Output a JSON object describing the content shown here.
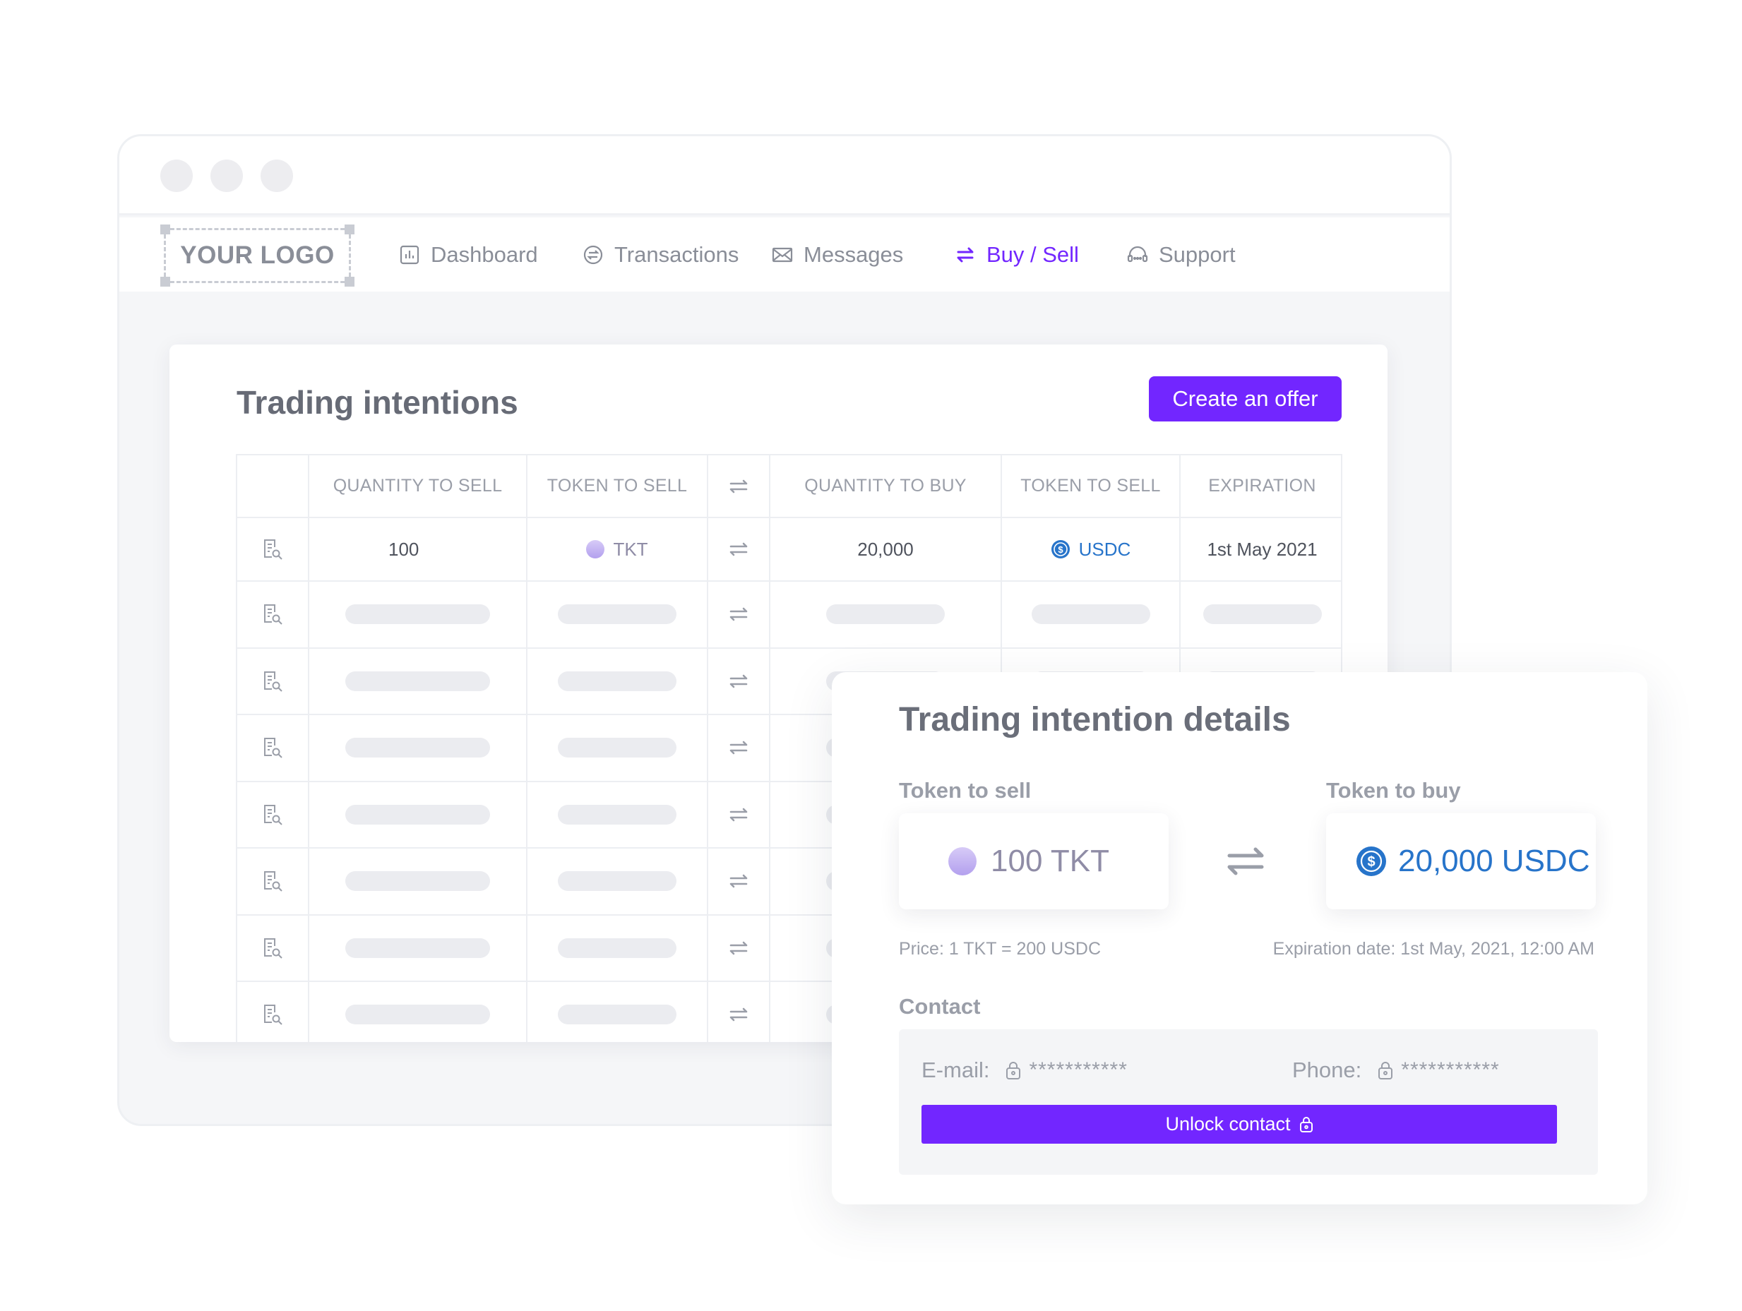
{
  "logo": "YOUR LOGO",
  "nav": [
    {
      "label": "Dashboard",
      "icon": "chart-icon"
    },
    {
      "label": "Transactions",
      "icon": "transactions-icon"
    },
    {
      "label": "Messages",
      "icon": "envelope-icon"
    },
    {
      "label": "Buy / Sell",
      "icon": "swap-icon",
      "active": true
    },
    {
      "label": "Support",
      "icon": "headset-icon"
    }
  ],
  "main": {
    "title": "Trading intentions",
    "create_button": "Create an offer",
    "table": {
      "headers": [
        "",
        "QUANTITY TO SELL",
        "TOKEN TO SELL",
        "",
        "QUANTITY TO BUY",
        "TOKEN TO SELL",
        "EXPIRATION"
      ],
      "first_row": {
        "quantity_to_sell": "100",
        "token_to_sell": "TKT",
        "quantity_to_buy": "20,000",
        "token_to_buy": "USDC",
        "expiration": "1st May 2021"
      },
      "placeholder_rows": 7
    }
  },
  "detail": {
    "title": "Trading intention details",
    "token_to_sell_label": "Token to sell",
    "token_to_buy_label": "Token to buy",
    "sell_amount": "100 TKT",
    "buy_amount": "20,000 USDC",
    "price": "Price: 1 TKT = 200 USDC",
    "expiration": "Expiration date: 1st May, 2021, 12:00 AM",
    "contact_label": "Contact",
    "email_label": "E-mail:",
    "email_value": "***********",
    "phone_label": "Phone:",
    "phone_value": "***********",
    "unlock_button": "Unlock contact"
  },
  "colors": {
    "accent": "#7226ff",
    "usdc": "#2774ca",
    "tkt": "#b3a0ee",
    "muted_text": "#9a9ea8",
    "background": "#f5f6f8"
  }
}
